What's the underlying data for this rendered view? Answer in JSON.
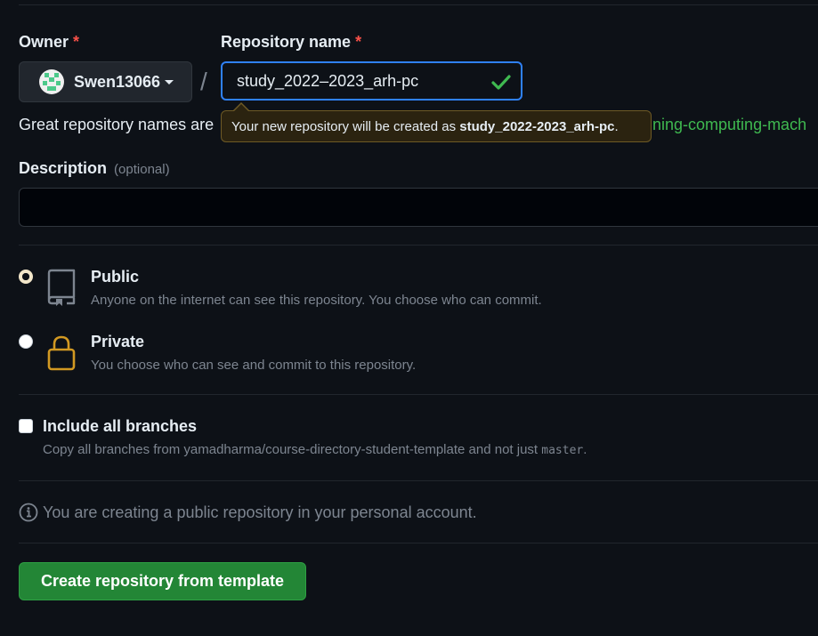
{
  "owner": {
    "label": "Owner",
    "required_mark": "*",
    "selected": "Swen13066"
  },
  "separator": "/",
  "repository": {
    "label": "Repository name",
    "required_mark": "*",
    "value": "study_2022–2023_arh-pc",
    "hint_prefix": "Great repository names are",
    "hint_suffix": "ning-computing-mach",
    "tooltip_prefix": "Your new repository will be created as",
    "tooltip_name": "study_2022-2023_arh-pc",
    "tooltip_end": "."
  },
  "description": {
    "label": "Description",
    "optional": "(optional)",
    "value": ""
  },
  "visibility": {
    "public": {
      "title": "Public",
      "desc": "Anyone on the internet can see this repository. You choose who can commit."
    },
    "private": {
      "title": "Private",
      "desc": "You choose who can see and commit to this repository."
    },
    "selected": "public"
  },
  "branches": {
    "title": "Include all branches",
    "desc_prefix": "Copy all branches from yamadharma/course-directory-student-template and not just",
    "default_branch": "master",
    "desc_end": "."
  },
  "info": {
    "text": "You are creating a public repository in your personal account."
  },
  "create_button": "Create repository from template",
  "colors": {
    "background": "#0d1117",
    "accent_blue": "#2f81f7",
    "success_green": "#3fb950",
    "button_green": "#238636",
    "required_red": "#f85149",
    "private_icon": "#d29922"
  }
}
